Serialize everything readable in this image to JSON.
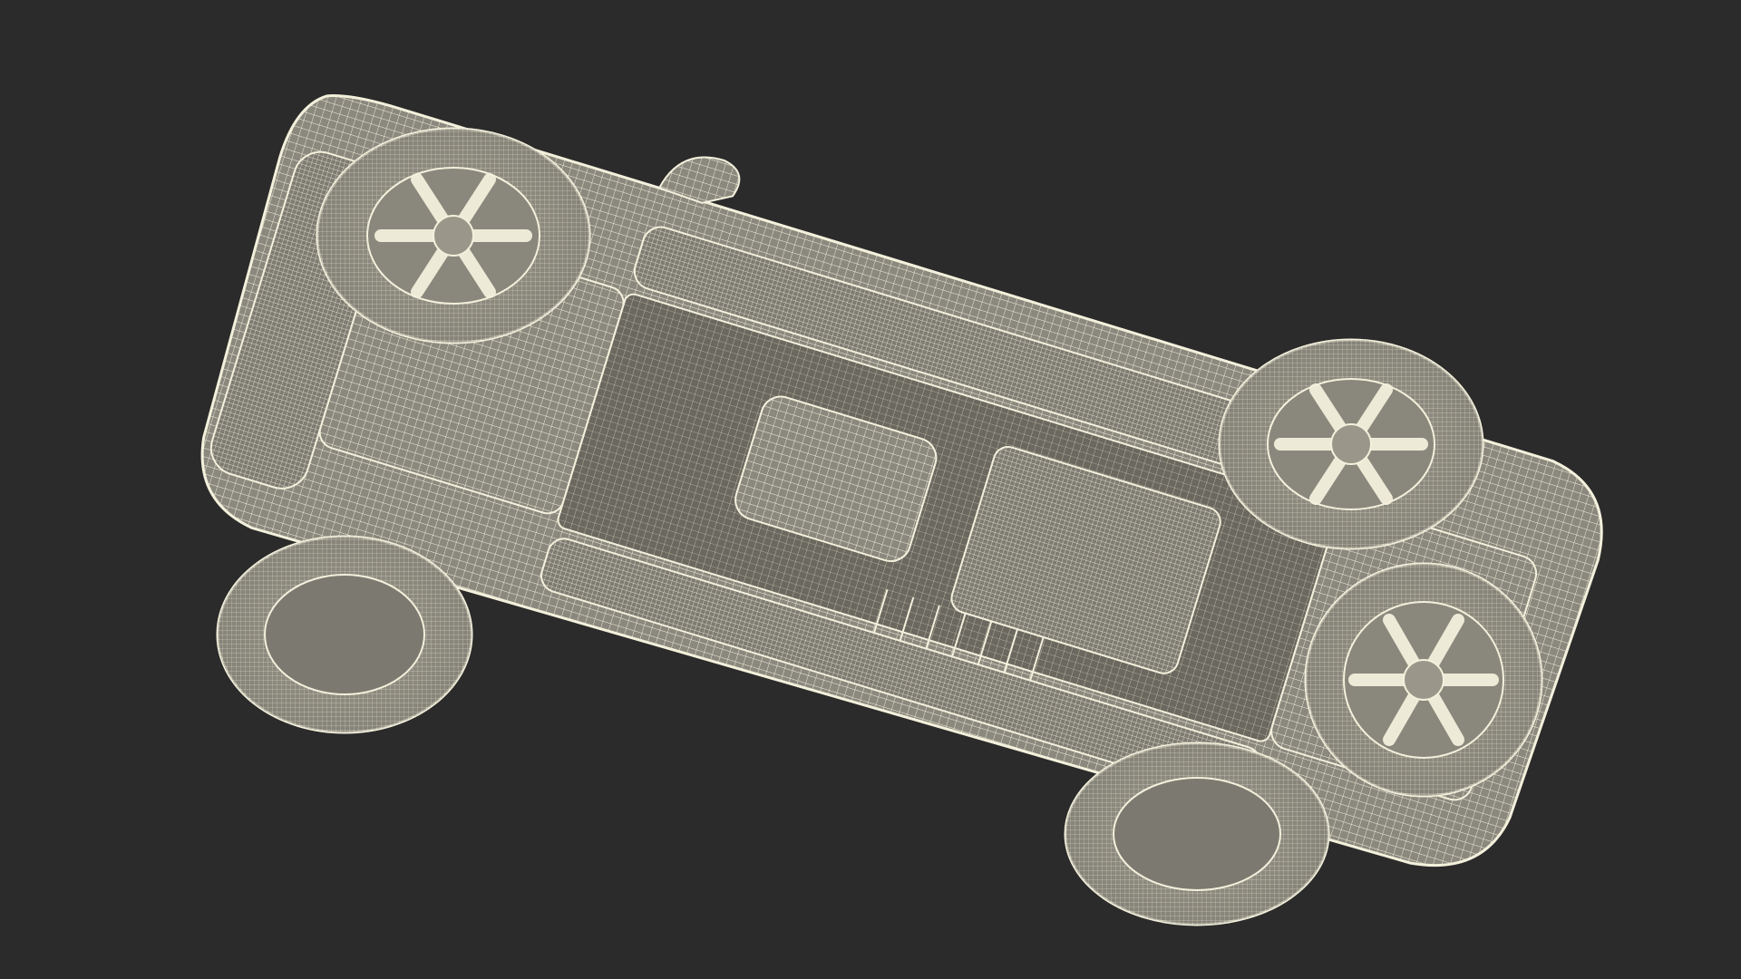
{
  "scene": {
    "subject": "car-underside-wireframe",
    "background_color": "#2b2b2b",
    "mesh_fill": "#8d8b80",
    "mesh_fill_dark": "#6f6d64",
    "wire_color": "#f3f0dc",
    "render_mode": "wireframe-on-shaded"
  },
  "wheels": [
    {
      "name": "rear-left-wheel",
      "spokes": 6
    },
    {
      "name": "rear-right-wheel",
      "spokes": 6
    },
    {
      "name": "front-left-wheel",
      "spokes": 6
    },
    {
      "name": "front-right-wheel",
      "spokes": 6
    }
  ]
}
